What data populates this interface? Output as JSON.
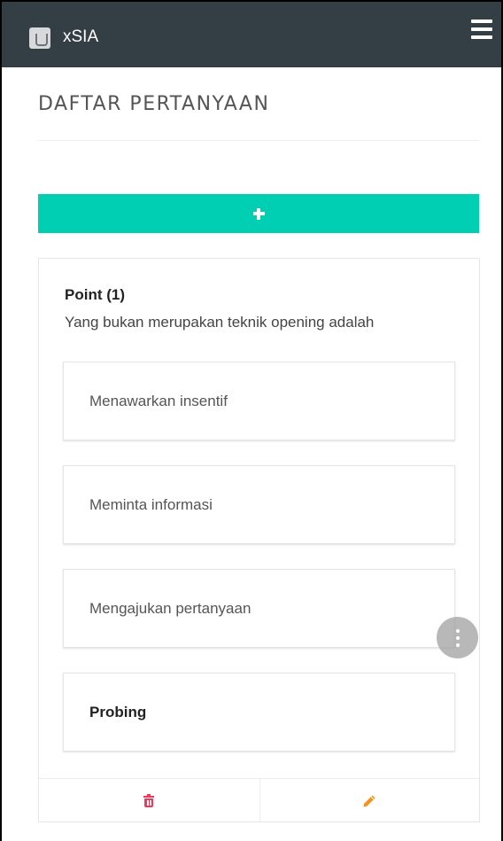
{
  "header": {
    "app_title": "xSIA",
    "logo_icon": "app-logo-icon",
    "menu_icon": "hamburger-menu-icon",
    "background_color": "#343e45"
  },
  "page": {
    "title": "DAFTAR PERTANYAAN"
  },
  "add_button": {
    "icon": "plus-icon",
    "color": "#00cfb4"
  },
  "question": {
    "point_label": "Point (1)",
    "text": "Yang bukan merupakan teknik opening adalah",
    "options": [
      {
        "label": "Menawarkan insentif",
        "is_answer": false
      },
      {
        "label": "Meminta informasi",
        "is_answer": false
      },
      {
        "label": "Mengajukan pertanyaan",
        "is_answer": false
      },
      {
        "label": "Probing",
        "is_answer": true
      }
    ],
    "actions": {
      "delete_icon": "trash-icon",
      "delete_color": "#f0385a",
      "edit_icon": "pencil-icon",
      "edit_color": "#f5931e"
    }
  },
  "floating_menu": {
    "icon": "more-vertical-icon"
  }
}
